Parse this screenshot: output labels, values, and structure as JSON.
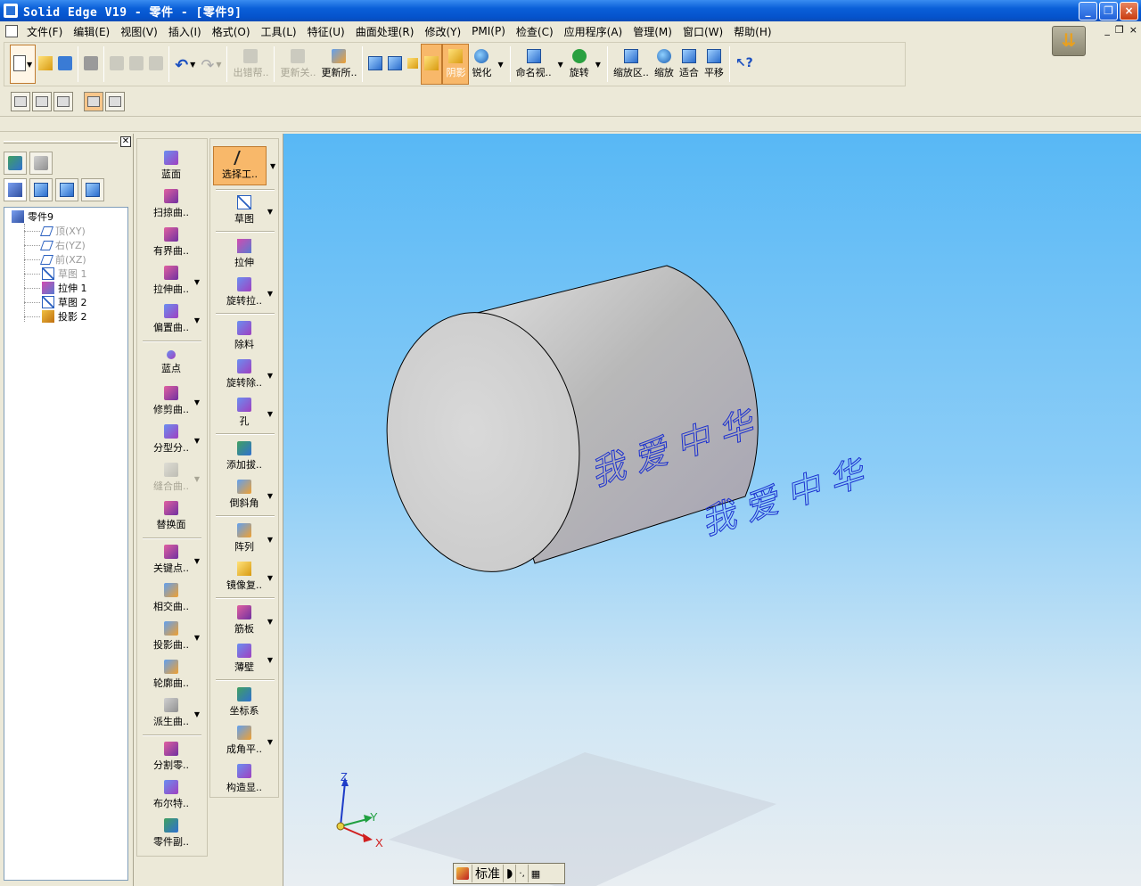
{
  "window": {
    "title": "Solid Edge V19 - 零件 - [零件9]",
    "controls": [
      "_",
      "❐",
      "×"
    ]
  },
  "menubar": {
    "items": [
      "文件(F)",
      "编辑(E)",
      "视图(V)",
      "插入(I)",
      "格式(O)",
      "工具(L)",
      "特征(U)",
      "曲面处理(R)",
      "修改(Y)",
      "PMI(P)",
      "检查(C)",
      "应用程序(A)",
      "管理(M)",
      "窗口(W)",
      "帮助(H)"
    ],
    "mdi": [
      "_",
      "❐",
      "×"
    ]
  },
  "toolbar_main": {
    "error_assist": "出错帮..",
    "update_off": "更新关..",
    "update_all": "更新所..",
    "shading": "阴影",
    "sharpen": "锐化",
    "named_view": "命名视..",
    "rotate": "旋转",
    "zoom_area": "缩放区..",
    "zoom": "缩放",
    "fit": "适合",
    "pan": "平移"
  },
  "feature_tree": {
    "root": "零件9",
    "items": [
      {
        "label": "顶(XY)",
        "dim": true,
        "icon": "plane-icon"
      },
      {
        "label": "右(YZ)",
        "dim": true,
        "icon": "plane-icon"
      },
      {
        "label": "前(XZ)",
        "dim": true,
        "icon": "plane-icon"
      },
      {
        "label": "草图 1",
        "dim": true,
        "icon": "sketch-icon"
      },
      {
        "label": "拉伸 1",
        "dim": false,
        "icon": "extrude-icon"
      },
      {
        "label": "草图 2",
        "dim": false,
        "icon": "sketch-icon"
      },
      {
        "label": "投影 2",
        "dim": false,
        "icon": "project-icon"
      }
    ]
  },
  "surface_tools": [
    "蓝面",
    "扫掠曲..",
    "有界曲..",
    "拉伸曲..",
    "偏置曲..",
    "蓝点",
    "修剪曲..",
    "分型分..",
    "缝合曲..",
    "替换面",
    "关键点..",
    "相交曲..",
    "投影曲..",
    "轮廓曲..",
    "派生曲..",
    "分割零..",
    "布尔特..",
    "零件副.."
  ],
  "feature_tools": [
    "选择工..",
    "草图",
    "拉伸",
    "旋转拉..",
    "除料",
    "旋转除..",
    "孔",
    "添加拔..",
    "倒斜角",
    "阵列",
    "镜像复..",
    "筋板",
    "薄壁",
    "坐标系",
    "成角平..",
    "构造显.."
  ],
  "viewport": {
    "projected_text_1": "我 爱 中 华",
    "projected_text_2": "我 爱 中 华",
    "axis_x": "X",
    "axis_y": "Y",
    "axis_z": "Z"
  },
  "statusbar": {
    "mode": "标准"
  },
  "colors": {
    "accent_active": "#f8b86a",
    "title_blue": "#0553cc",
    "projected_text": "#1a2fd0"
  }
}
